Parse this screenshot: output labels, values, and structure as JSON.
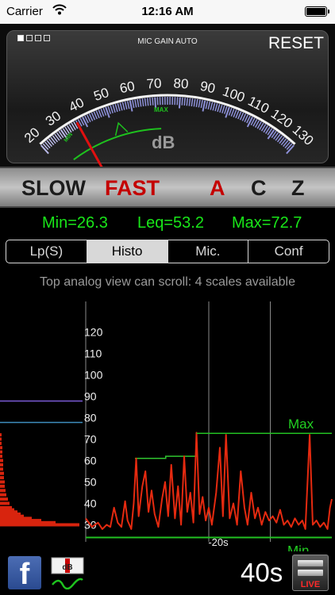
{
  "status_bar": {
    "carrier": "Carrier",
    "time": "12:16 AM"
  },
  "meter": {
    "mic_gain": "MIC GAIN AUTO",
    "reset_label": "RESET",
    "scale_labels": [
      "20",
      "30",
      "40",
      "50",
      "60",
      "70",
      "80",
      "90",
      "100",
      "110",
      "120",
      "130"
    ],
    "unit": "dB",
    "min_tag": "MIN",
    "max_tag": "MAX",
    "needle_value_db": 37,
    "page_count": 4,
    "active_page": 1
  },
  "weighting": {
    "slow": "SLOW",
    "fast": "FAST",
    "a": "A",
    "c": "C",
    "z": "Z",
    "active_speed": "FAST",
    "active_weight": "A"
  },
  "readouts": {
    "min": "Min=26.3",
    "leq": "Leq=53.2",
    "max": "Max=72.7"
  },
  "tabs": [
    "Lp(S)",
    "Histo",
    "Mic.",
    "Conf"
  ],
  "active_tab": "Histo",
  "hint": "Top analog view can scroll: 4 scales available",
  "chart_data": {
    "type": "line",
    "y_tick_labels": [
      "120",
      "110",
      "100",
      "90",
      "80",
      "70",
      "60",
      "50",
      "40",
      "30"
    ],
    "ylim": [
      25,
      125
    ],
    "x_tick_labels": [
      "-20s"
    ],
    "x_range_s": [
      -40,
      0
    ],
    "max_label": "Max",
    "min_label": "Min",
    "max_db": 72.7,
    "min_db": 26.3,
    "leq_steps": [
      {
        "from_s": -32,
        "to_s": -27,
        "db": 61
      },
      {
        "from_s": -27,
        "to_s": -22,
        "db": 62
      },
      {
        "from_s": -22,
        "to_s": 0,
        "db": 72.7
      }
    ],
    "series": [
      {
        "values": [
          [
            -40,
            33
          ],
          [
            -39,
            29
          ],
          [
            -38,
            31
          ],
          [
            -37.3,
            28
          ],
          [
            -36.6,
            30
          ],
          [
            -36,
            29
          ],
          [
            -35.4,
            38
          ],
          [
            -34.8,
            31
          ],
          [
            -34.2,
            29
          ],
          [
            -33.6,
            41
          ],
          [
            -33.2,
            32
          ],
          [
            -32.6,
            28
          ],
          [
            -32.2,
            40
          ],
          [
            -31.8,
            61
          ],
          [
            -31.4,
            34
          ],
          [
            -30.8,
            48
          ],
          [
            -30.3,
            55
          ],
          [
            -29.8,
            36
          ],
          [
            -29.3,
            46
          ],
          [
            -28.8,
            35
          ],
          [
            -28.2,
            29
          ],
          [
            -27.6,
            42
          ],
          [
            -27.1,
            50
          ],
          [
            -26.6,
            34
          ],
          [
            -26.1,
            58
          ],
          [
            -25.5,
            33
          ],
          [
            -25,
            48
          ],
          [
            -24.5,
            30
          ],
          [
            -24,
            62
          ],
          [
            -23.5,
            36
          ],
          [
            -23,
            45
          ],
          [
            -22.5,
            31
          ],
          [
            -22,
            73
          ],
          [
            -21.5,
            35
          ],
          [
            -21,
            43
          ],
          [
            -20.5,
            32
          ],
          [
            -20,
            38
          ],
          [
            -19.5,
            30
          ],
          [
            -18.8,
            45
          ],
          [
            -18.2,
            66
          ],
          [
            -17.7,
            34
          ],
          [
            -17.2,
            72
          ],
          [
            -16.6,
            33
          ],
          [
            -16,
            40
          ],
          [
            -15.4,
            30
          ],
          [
            -14.8,
            55
          ],
          [
            -14.2,
            38
          ],
          [
            -13.7,
            30
          ],
          [
            -13.1,
            45
          ],
          [
            -12.5,
            33
          ],
          [
            -12,
            38
          ],
          [
            -11.4,
            30
          ],
          [
            -10.8,
            36
          ],
          [
            -10.2,
            32
          ],
          [
            -9.6,
            34
          ],
          [
            -9,
            31
          ],
          [
            -8.4,
            37
          ],
          [
            -7.8,
            30
          ],
          [
            -7.2,
            32
          ],
          [
            -6.6,
            29
          ],
          [
            -6,
            33
          ],
          [
            -5.4,
            30
          ],
          [
            -4.8,
            32
          ],
          [
            -4.3,
            28
          ],
          [
            -3.6,
            72
          ],
          [
            -3.1,
            30
          ],
          [
            -2.5,
            32
          ],
          [
            -1.9,
            29
          ],
          [
            -1.3,
            31
          ],
          [
            -0.7,
            28
          ],
          [
            -0.3,
            38
          ],
          [
            0,
            42
          ]
        ]
      }
    ],
    "colors": {
      "signal": "#e52a10",
      "max_min_line": "#22c122",
      "leq_line": "#2fc42f"
    }
  },
  "bottom": {
    "facebook": "f",
    "duration": "40s",
    "live_label": "LIVE"
  }
}
